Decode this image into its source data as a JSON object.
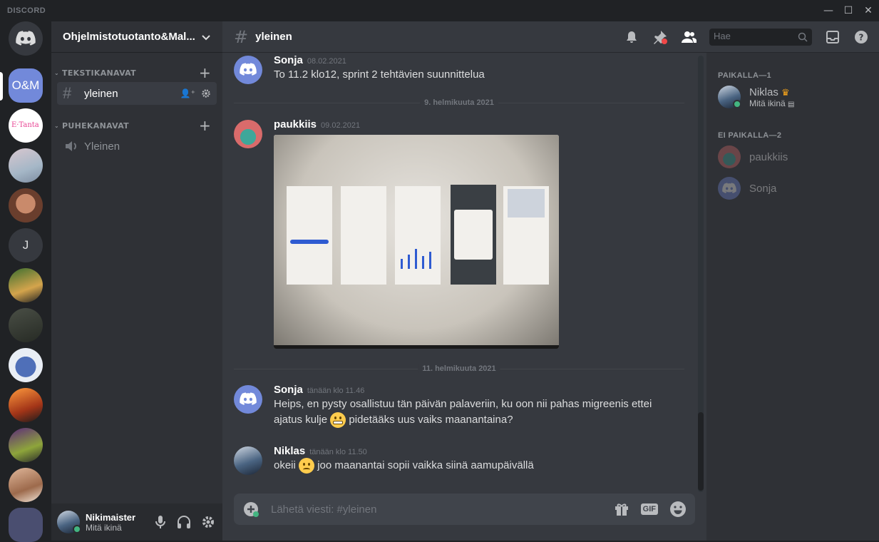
{
  "app": {
    "brand": "DISCORD"
  },
  "window_controls": {
    "minimize": "—",
    "maximize": "☐",
    "close": "✕"
  },
  "guilds": [
    {
      "name": "home",
      "label": ""
    },
    {
      "name": "O&M",
      "label": "O&M"
    },
    {
      "name": "J",
      "label": "J"
    }
  ],
  "server": {
    "name": "Ohjelmistotuotanto&Mal..."
  },
  "categories": {
    "text": "TEKSTIKANAVAT",
    "voice": "PUHEKANAVAT"
  },
  "channels": {
    "text_channel": "yleinen",
    "voice_channel": "Yleinen"
  },
  "user_panel": {
    "name": "Nikimaister",
    "status": "Mitä ikinä"
  },
  "header": {
    "channel": "yleinen",
    "search_placeholder": "Hae"
  },
  "messages": [
    {
      "author": "Sonja",
      "timestamp": "08.02.2021",
      "text": "To 11.2 klo12, sprint 2 tehtävien suunnittelua"
    },
    {
      "author": "paukkiis",
      "timestamp": "09.02.2021",
      "text": ""
    },
    {
      "author": "Sonja",
      "timestamp": "tänään klo 11.46",
      "text_1": "Heips, en pysty osallistuu tän päivän palaveriin, ku oon nii pahas migreenis ettei",
      "text_2a": "ajatus kulje",
      "text_2b": "pidetääks uus vaiks maanantaina?"
    },
    {
      "author": "Niklas",
      "timestamp": "tänään klo 11.50",
      "text_a": "okeii",
      "text_b": "joo maanantai sopii vaikka siinä aamupäivällä"
    }
  ],
  "dividers": [
    "9. helmikuuta 2021",
    "11. helmikuuta 2021"
  ],
  "composer": {
    "placeholder": "Lähetä viesti: #yleinen",
    "gif": "GIF"
  },
  "members": {
    "online_header": "PAIKALLA—1",
    "offline_header": "EI PAIKALLA—2",
    "online": [
      {
        "name": "Niklas",
        "status": "Mitä ikinä"
      }
    ],
    "offline": [
      {
        "name": "paukkiis"
      },
      {
        "name": "Sonja"
      }
    ]
  },
  "colors": {
    "blurple": "#7289da",
    "online": "#43b581",
    "background": "#36393f",
    "sidebar": "#2f3136"
  }
}
